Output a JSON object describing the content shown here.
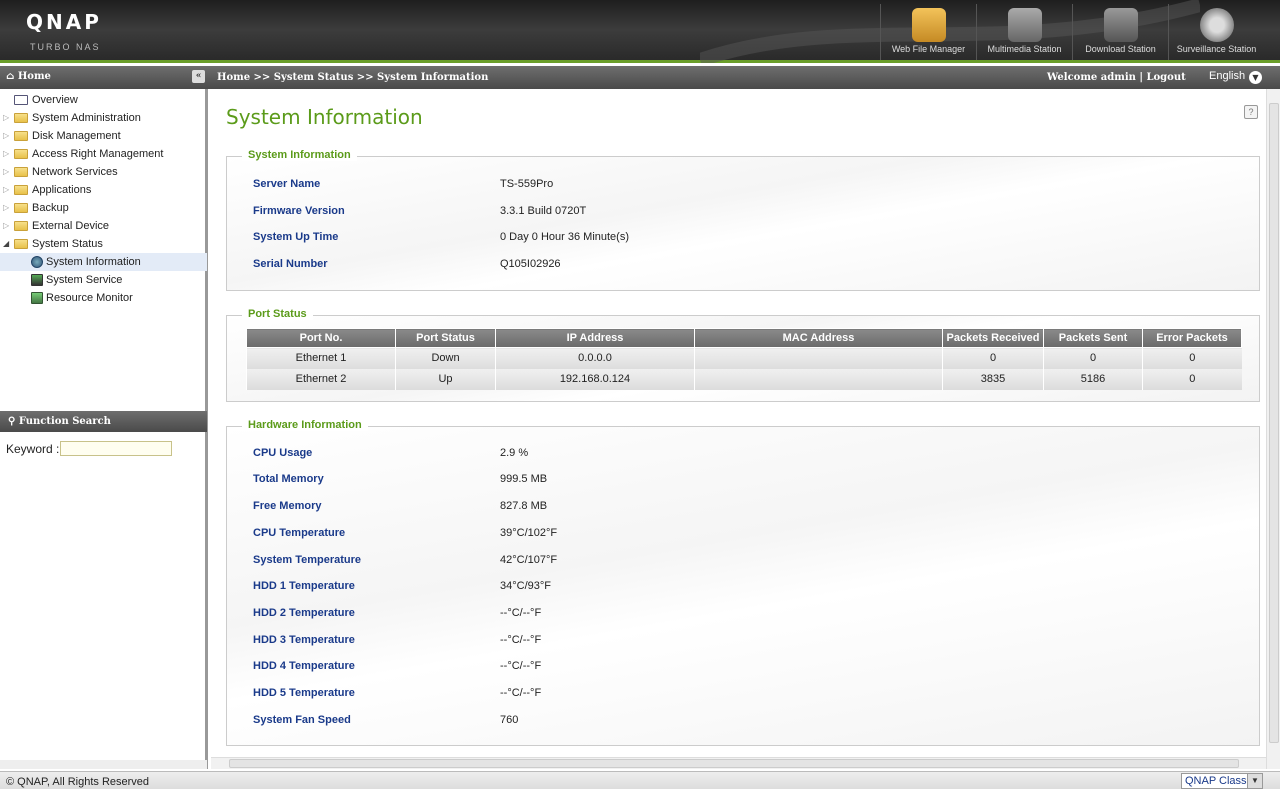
{
  "header": {
    "logo": "QNAP",
    "logo_sub": "TURBO NAS",
    "apps": [
      {
        "label": "Web File Manager",
        "icon": "folder-search-icon",
        "color": "#d9a53a"
      },
      {
        "label": "Multimedia Station",
        "icon": "film-icon",
        "color": "#777777"
      },
      {
        "label": "Download Station",
        "icon": "download-icon",
        "color": "#777777"
      },
      {
        "label": "Surveillance Station",
        "icon": "camera-icon",
        "color": "#888888"
      }
    ]
  },
  "topbar": {
    "home": "Home",
    "breadcrumb": "Home >> System Status >> System Information",
    "welcome": "Welcome admin | Logout",
    "language": "English"
  },
  "sidebar": {
    "items": [
      {
        "label": "Overview",
        "icon": "list-icon"
      },
      {
        "label": "System Administration",
        "icon": "folder-icon"
      },
      {
        "label": "Disk Management",
        "icon": "folder-icon"
      },
      {
        "label": "Access Right Management",
        "icon": "folder-icon"
      },
      {
        "label": "Network Services",
        "icon": "folder-icon"
      },
      {
        "label": "Applications",
        "icon": "folder-icon"
      },
      {
        "label": "Backup",
        "icon": "folder-icon"
      },
      {
        "label": "External Device",
        "icon": "folder-icon"
      },
      {
        "label": "System Status",
        "icon": "folder-open-icon"
      }
    ],
    "children": [
      {
        "label": "System Information",
        "icon": "info-icon",
        "selected": true
      },
      {
        "label": "System Service",
        "icon": "service-icon"
      },
      {
        "label": "Resource Monitor",
        "icon": "monitor-icon"
      }
    ],
    "function_search": "Function Search",
    "keyword_label": "Keyword :"
  },
  "main": {
    "title": "System Information",
    "system_info": {
      "legend": "System Information",
      "rows": [
        {
          "label": "Server Name",
          "value": "TS-559Pro"
        },
        {
          "label": "Firmware Version",
          "value": "3.3.1 Build 0720T"
        },
        {
          "label": "System Up Time",
          "value": "0 Day 0 Hour 36 Minute(s)"
        },
        {
          "label": "Serial Number",
          "value": "Q105I02926"
        }
      ]
    },
    "port_status": {
      "legend": "Port Status",
      "headers": [
        "Port No.",
        "Port Status",
        "IP Address",
        "MAC Address",
        "Packets Received",
        "Packets Sent",
        "Error Packets"
      ],
      "rows": [
        [
          "Ethernet 1",
          "Down",
          "0.0.0.0",
          "",
          "0",
          "0",
          "0"
        ],
        [
          "Ethernet 2",
          "Up",
          "192.168.0.124",
          "",
          "3835",
          "5186",
          "0"
        ]
      ]
    },
    "hardware": {
      "legend": "Hardware Information",
      "rows": [
        {
          "label": "CPU Usage",
          "value": "2.9 %"
        },
        {
          "label": "Total Memory",
          "value": "999.5 MB"
        },
        {
          "label": "Free Memory",
          "value": "827.8 MB"
        },
        {
          "label": "CPU Temperature",
          "value": "39°C/102°F"
        },
        {
          "label": "System Temperature",
          "value": "42°C/107°F"
        },
        {
          "label": "HDD 1 Temperature",
          "value": "34°C/93°F"
        },
        {
          "label": "HDD 2 Temperature",
          "value": "--°C/--°F"
        },
        {
          "label": "HDD 3 Temperature",
          "value": "--°C/--°F"
        },
        {
          "label": "HDD 4 Temperature",
          "value": "--°C/--°F"
        },
        {
          "label": "HDD 5 Temperature",
          "value": "--°C/--°F"
        },
        {
          "label": "System Fan Speed",
          "value": "760"
        }
      ]
    }
  },
  "footer": {
    "copyright": "© QNAP, All Rights Reserved",
    "theme": "QNAP Classic"
  }
}
